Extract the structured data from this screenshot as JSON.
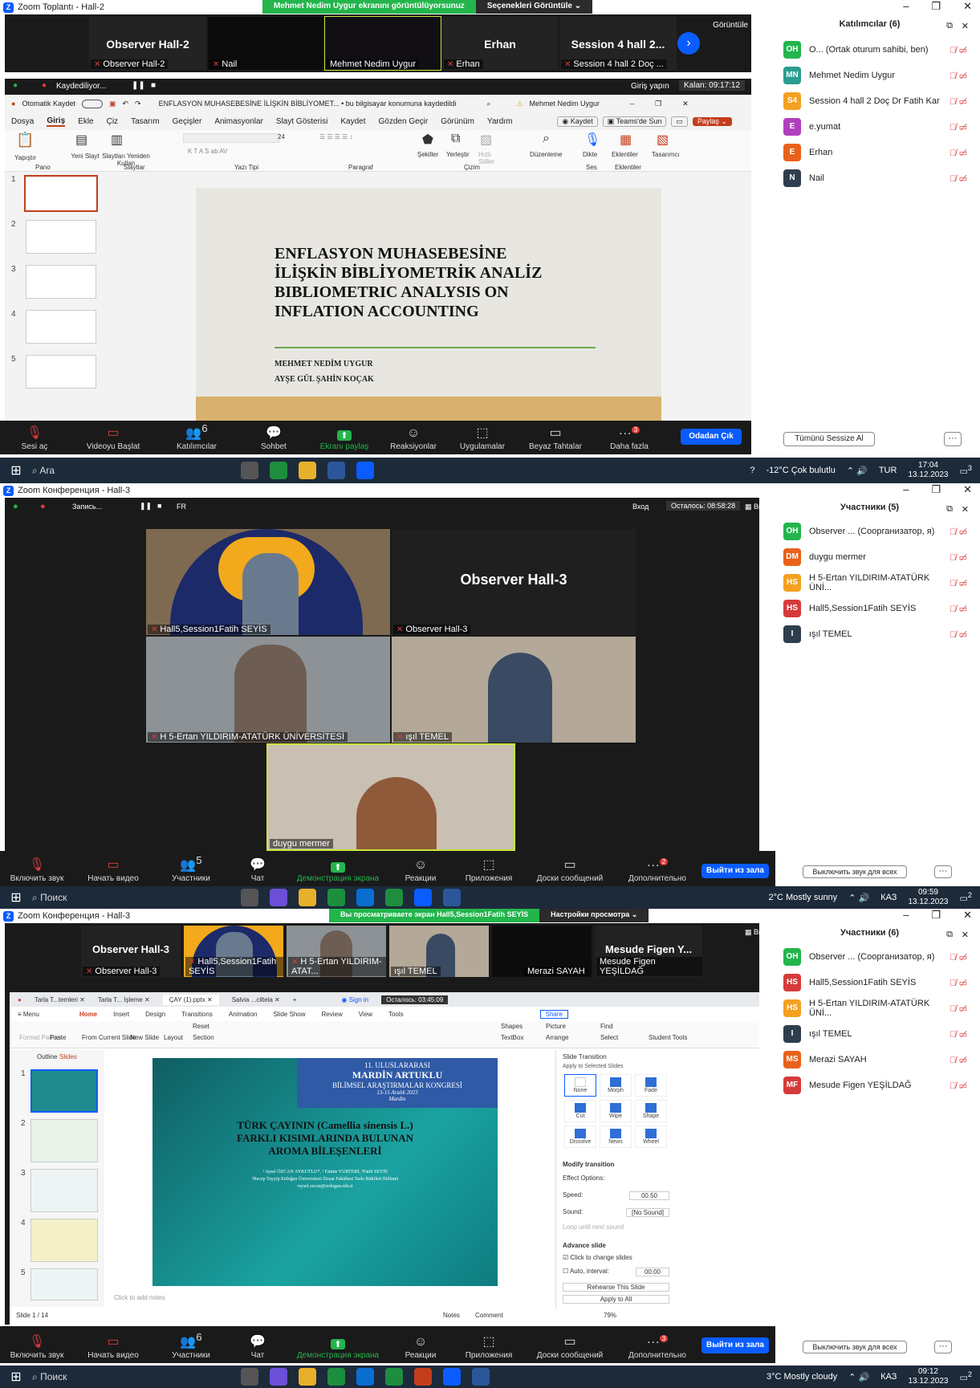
{
  "panel1": {
    "window_title": "Zoom Toplantı - Hall-2",
    "share_banner": "Mehmet Nedim Uygur ekranını görüntülüyorsunuz",
    "share_options": "Seçenekleri Görüntüle",
    "view_label": "Görüntüle",
    "tiles": [
      {
        "name": "Observer  Hall-2",
        "caption": "Observer  Hall-2"
      },
      {
        "name": "",
        "caption": "Nail"
      },
      {
        "name": "",
        "caption": "Mehmet Nedim Uygur"
      },
      {
        "name": "Erhan",
        "caption": "Erhan"
      },
      {
        "name": "Session 4 hall 2...",
        "caption": "Session 4 hall 2 Doç ..."
      }
    ],
    "recording": "Kaydediliyor...",
    "login": "Giriş yapın",
    "remaining": "Kalan: 09:17:12",
    "ppt": {
      "autosave": "Otomatik Kaydet",
      "doc_title": "ENFLASYON MUHASEBESİNE İLİŞKİN BİBLİYOMET... • bu bilgisayar konumuna kaydedildi",
      "user": "Mehmet Nedim Uygur",
      "tabs": [
        "Dosya",
        "Giriş",
        "Ekle",
        "Çiz",
        "Tasarım",
        "Geçişler",
        "Animasyonlar",
        "Slayt Gösterisi",
        "Kaydet",
        "Gözden Geçir",
        "Görünüm",
        "Yardım"
      ],
      "kaydet_btn": "Kaydet",
      "teams_btn": "Teams'de Sun",
      "share_btn": "Paylaş",
      "groups": [
        "Pano",
        "Slaytlar",
        "Yazı Tipi",
        "Paragraf",
        "Çizim",
        "Ses",
        "Eklentiler"
      ],
      "ribbon_items": [
        "Yapıştır",
        "Yeni Slayt",
        "Slaytları Yeniden Kullan",
        "Şekiller",
        "Yerleştir",
        "Hızlı Stiller",
        "Düzenleme",
        "Dikte",
        "Eklentiler",
        "Tasarımcı"
      ],
      "font_size": "24",
      "slide_title": [
        "ENFLASYON MUHASEBESİNE",
        "İLİŞKİN BİBLİYOMETRİK ANALİZ",
        "BIBLIOMETRIC ANALYSIS ON",
        "INFLATION ACCOUNTING"
      ],
      "authors": [
        "MEHMET NEDİM UYGUR",
        "AYŞE GÜL ŞAHİN KOÇAK"
      ],
      "thumb_nums": [
        "1",
        "2",
        "3",
        "4",
        "5"
      ]
    },
    "participants_title": "Katılımcılar (6)",
    "participants": [
      {
        "initials": "OH",
        "name": "O... (Ortak oturum sahibi, ben)",
        "color": "#23b54c"
      },
      {
        "initials": "MN",
        "name": "Mehmet Nedim Uygur",
        "color": "#2a9d8f"
      },
      {
        "initials": "S4",
        "name": "Session 4 hall 2 Doç Dr Fatih Kar",
        "color": "#f4a020"
      },
      {
        "initials": "E",
        "name": "e.yumat",
        "color": "#b03fbf"
      },
      {
        "initials": "E",
        "name": "Erhan",
        "color": "#e8621a"
      },
      {
        "initials": "N",
        "name": "Nail",
        "color": "#2f3e4e"
      }
    ],
    "mute_all": "Tümünü Sessize Al",
    "toolbar": [
      "Sesi aç",
      "Videoyu Başlat",
      "Katılımcılar",
      "Sohbet",
      "Ekranı paylaş",
      "Reaksiyonlar",
      "Uygulamalar",
      "Beyaz Tahtalar",
      "Daha fazla"
    ],
    "participants_count": "6",
    "more_badge": "3",
    "leave": "Odadan Çık",
    "taskbar": {
      "search": "Ara",
      "weather": "-12°C  Çok bulutlu",
      "lang": "TUR",
      "time": "17:04",
      "date": "13.12.2023",
      "notif": "3"
    }
  },
  "panel2": {
    "window_title": "Zoom Конференция - Hall-3",
    "recording": "Запись...",
    "lang": "FR",
    "login": "Вход",
    "remaining": "Осталось: 08:58:28",
    "view": "Вид",
    "tiles": [
      {
        "name": "",
        "caption": "Hall5,Session1Fatih SEYİS"
      },
      {
        "name": "Observer  Hall-3",
        "caption": "Observer  Hall-3"
      },
      {
        "name": "",
        "caption": "H 5-Ertan YILDIRIM-ATATÜRK ÜNİVERSİTESİ"
      },
      {
        "name": "",
        "caption": "ışıl TEMEL"
      },
      {
        "name": "",
        "caption": "duygu mermer"
      }
    ],
    "participants_title": "Участники (5)",
    "participants": [
      {
        "initials": "OH",
        "name": "Observer ... (Соорганизатор, я)",
        "color": "#23b54c"
      },
      {
        "initials": "DM",
        "name": "duygu mermer",
        "color": "#e8621a"
      },
      {
        "initials": "HS",
        "name": "H 5-Ertan YILDIRIM-ATATÜRK ÜNİ...",
        "color": "#f4a020"
      },
      {
        "initials": "HS",
        "name": "Hall5,Session1Fatih SEYİS",
        "color": "#d63a3a"
      },
      {
        "initials": "I",
        "name": "ışıl TEMEL",
        "color": "#2f3e4e"
      }
    ],
    "mute_all": "Выключить звук для всех",
    "toolbar": [
      "Включить звук",
      "Начать видео",
      "Участники",
      "Чат",
      "Демонстрация экрана",
      "Реакции",
      "Приложения",
      "Доски сообщений",
      "Дополнительно"
    ],
    "participants_count": "5",
    "more_badge": "2",
    "leave": "Выйти из зала",
    "taskbar": {
      "search": "Поиск",
      "weather": "2°C  Mostly sunny",
      "lang": "КАЗ",
      "time": "09:59",
      "date": "13.12.2023",
      "notif": "2"
    }
  },
  "panel3": {
    "window_title": "Zoom Конференция - Hall-3",
    "share_banner": "Вы просматриваете экран Hall5,Session1Fatih SEYİS",
    "share_options": "Настройки просмотра",
    "view": "Вид",
    "tiles": [
      {
        "name": "Observer  Hall-3",
        "caption": "Observer  Hall-3"
      },
      {
        "name": "",
        "caption": "Hall5,Session1Fatih SEYİS"
      },
      {
        "name": "",
        "caption": "H 5-Ertan YILDIRIM-ATAT..."
      },
      {
        "name": "",
        "caption": "ışıl TEMEL"
      },
      {
        "name": "",
        "caption": "Merazi SAYAH"
      },
      {
        "name": "Mesude Figen Y...",
        "caption": "Mesude Figen YEŞİLDAĞ"
      }
    ],
    "wps": {
      "tabs": [
        "Tarla T...temleri",
        "Tarla T... İşleme",
        "ÇAY (1).pptx",
        "Salvia ...ciltela"
      ],
      "menu": "Menu",
      "ribbon": [
        "Home",
        "Insert",
        "Design",
        "Transitions",
        "Animation",
        "Slide Show",
        "Review",
        "View",
        "Tools"
      ],
      "sign_in": "Sign in",
      "remaining": "Осталось: 03:45:09",
      "share": "Share",
      "outline": "Outline",
      "slides": "Slides",
      "tools": [
        "Format Painter",
        "Paste",
        "From Current Slide",
        "New Slide",
        "Layout",
        "Reset",
        "Section",
        "Shapes",
        "Picture",
        "TextBox",
        "Arrange",
        "Find",
        "Select",
        "Student Tools"
      ],
      "slide_header": [
        "11. ULUSLARARASI",
        "MARDİN ARTUKLU",
        "BİLİMSEL ARAŞTIRMALAR KONGRESİ",
        "13-15 Aralık 2023",
        "Mardin"
      ],
      "slide_title": [
        "TÜRK ÇAYININ (Camellia sinensis L.)",
        "FARKLI KISIMLARINDA BULUNAN",
        "AROMA BİLEŞENLERİ"
      ],
      "slide_authors": "¹ Aysel ÖZCAN AYKUTLU*, ¹ Emine YURTERİ, ¹Fatih SEYİS",
      "slide_affil": "¹Recep Tayyip Erdoğan Üniversitesi Ziraat Fakültesi Tarla Bitkileri Bölümü",
      "slide_email": "•aysel.ozcan@erdogan.edu.tr",
      "notes": "Click to add notes",
      "status": "Slide 1 / 14",
      "zoom": "79%",
      "notes_btn": "Notes",
      "comment_btn": "Comment",
      "transition_title": "Slide Transition",
      "apply_selected": "Apply to Selected Slides",
      "transitions": [
        "None",
        "Morph",
        "Fade",
        "Cut",
        "Wipe",
        "Shape",
        "Dissolve",
        "News",
        "Wheel"
      ],
      "modify": "Modify transition",
      "effect_options": "Effect Options:",
      "speed_label": "Speed:",
      "speed_value": "00.50",
      "sound_label": "Sound:",
      "sound_value": "[No Sound]",
      "loop": "Loop until next sound",
      "advance": "Advance slide",
      "click_change": "Click to change slides",
      "auto_interval": "Auto, interval:",
      "interval_value": "00:00",
      "rehearse": "Rehearse This Slide",
      "apply_all": "Apply to All",
      "thumb_nums": [
        "1",
        "2",
        "3",
        "4",
        "5"
      ]
    },
    "participants_title": "Участники (6)",
    "participants": [
      {
        "initials": "OH",
        "name": "Observer ... (Соорганизатор, я)",
        "color": "#23b54c"
      },
      {
        "initials": "HS",
        "name": "Hall5,Session1Fatih SEYİS",
        "color": "#d63a3a"
      },
      {
        "initials": "HS",
        "name": "H 5-Ertan YILDIRIM-ATATÜRK ÜNİ...",
        "color": "#f4a020"
      },
      {
        "initials": "I",
        "name": "ışıl TEMEL",
        "color": "#2f3e4e"
      },
      {
        "initials": "MS",
        "name": "Merazi SAYAH",
        "color": "#e8621a"
      },
      {
        "initials": "MF",
        "name": "Mesude Figen YEŞİLDAĞ",
        "color": "#d63a3a"
      }
    ],
    "mute_all": "Выключить звук для всех",
    "toolbar": [
      "Включить звук",
      "Начать видео",
      "Участники",
      "Чат",
      "Демонстрация экрана",
      "Реакции",
      "Приложения",
      "Доски сообщений",
      "Дополнительно"
    ],
    "participants_count": "6",
    "more_badge": "3",
    "leave": "Выйти из зала",
    "taskbar": {
      "search": "Поиск",
      "weather": "3°C  Mostly cloudy",
      "lang": "КАЗ",
      "time": "09:12",
      "date": "13.12.2023",
      "notif": "2"
    }
  }
}
